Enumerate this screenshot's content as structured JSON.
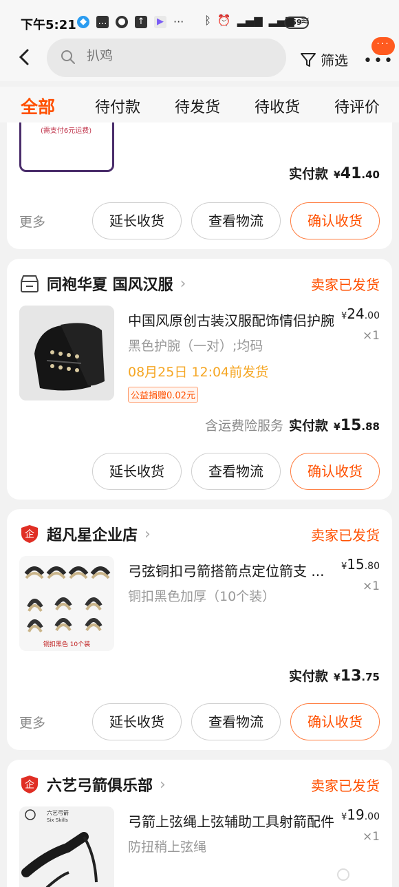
{
  "status_bar": {
    "time": "下午5:21",
    "battery": "59"
  },
  "header": {
    "search_placeholder": "扒鸡",
    "filter_label": "筛选",
    "badge_dots": "···"
  },
  "tabs": [
    {
      "label": "全部",
      "active": true
    },
    {
      "label": "待付款"
    },
    {
      "label": "待发货"
    },
    {
      "label": "待收货"
    },
    {
      "label": "待评价"
    }
  ],
  "prev_order": {
    "image_note": "(需支付6元运费)",
    "paid_label": "实付款",
    "currency": "¥",
    "paid_int": "41",
    "paid_dec": ".40",
    "more": "更多",
    "btn_extend": "延长收货",
    "btn_logistics": "查看物流",
    "btn_confirm": "确认收货"
  },
  "orders": [
    {
      "shop": "同袍华夏 国风汉服",
      "status": "卖家已发货",
      "title": "中国风原创古装汉服配饰情侣护腕",
      "price_currency": "¥",
      "price_int": "24",
      "price_dec": ".00",
      "qty": "×1",
      "spec": "黑色护腕（一对）;均码",
      "ship_time": "08月25日 12:04前发货",
      "donation": "公益捐赠0.02元",
      "insurance": "含运费险服务",
      "paid_label": "实付款",
      "paid_int": "15",
      "paid_dec": ".88",
      "btn_extend": "延长收货",
      "btn_logistics": "查看物流",
      "btn_confirm": "确认收货"
    },
    {
      "shop": "超凡星企业店",
      "status": "卖家已发货",
      "title": "弓弦铜扣弓箭搭箭点定位箭支 ...",
      "price_currency": "¥",
      "price_int": "15",
      "price_dec": ".80",
      "qty": "×1",
      "spec": "铜扣黑色加厚（10个装）",
      "thumb_caption": "铜扣黑色 10个装",
      "paid_label": "实付款",
      "paid_int": "13",
      "paid_dec": ".75",
      "more": "更多",
      "btn_extend": "延长收货",
      "btn_logistics": "查看物流",
      "btn_confirm": "确认收货"
    },
    {
      "shop": "六艺弓箭俱乐部",
      "status": "卖家已发货",
      "title": "弓箭上弦绳上弦辅助工具射箭配件",
      "price_currency": "¥",
      "price_int": "19",
      "price_dec": ".00",
      "qty": "×1",
      "spec": "防扭稍上弦绳",
      "thumb_caption_cn": "六艺弓箭",
      "thumb_caption_en": "Six Skills"
    }
  ],
  "colors": {
    "accent": "#ff5000",
    "ship_time": "#f5a623",
    "shop_badge": "#e02e24"
  }
}
